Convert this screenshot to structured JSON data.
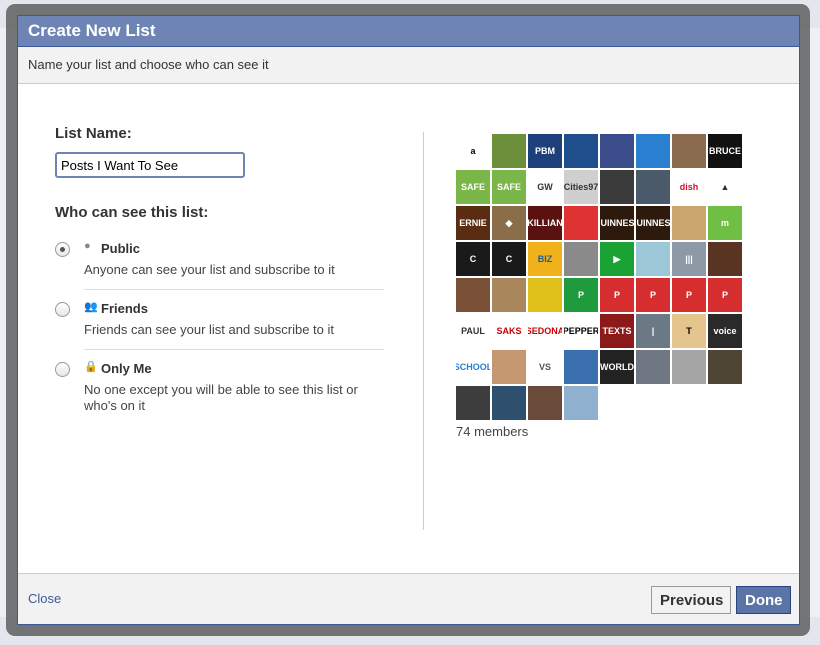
{
  "dialog": {
    "title": "Create New List",
    "subtitle": "Name your list and choose who can see it",
    "list_name_label": "List Name:",
    "list_name_value": "Posts I Want To See",
    "visibility_label": "Who can see this list:",
    "options": [
      {
        "title": "Public",
        "description": "Anyone can see your list and subscribe to it",
        "icon": "globe-icon",
        "checked": true
      },
      {
        "title": "Friends",
        "description": "Friends can see your list and subscribe to it",
        "icon": "friends-icon",
        "checked": false
      },
      {
        "title": "Only Me",
        "description": "No one except you will be able to see this list or who's on it",
        "icon": "lock-icon",
        "checked": false
      }
    ],
    "members_text": "74 members",
    "close_label": "Close",
    "previous_label": "Previous",
    "done_label": "Done"
  },
  "member_tiles": [
    {
      "color": "#ffffff",
      "fg": "#000",
      "text": "a"
    },
    {
      "color": "#6b8f3a",
      "fg": "#fff",
      "text": ""
    },
    {
      "color": "#1d3f7a",
      "fg": "#fff",
      "text": "PBM"
    },
    {
      "color": "#1f4e8c",
      "fg": "#fff",
      "text": ""
    },
    {
      "color": "#3a4d8a",
      "fg": "#fff",
      "text": ""
    },
    {
      "color": "#2a7fd1",
      "fg": "#fff",
      "text": ""
    },
    {
      "color": "#8a6b4d",
      "fg": "#fff",
      "text": ""
    },
    {
      "color": "#111111",
      "fg": "#fff",
      "text": "BRUCE"
    },
    {
      "color": "#7ab648",
      "fg": "#fff",
      "text": "SAFE"
    },
    {
      "color": "#7ab648",
      "fg": "#fff",
      "text": "SAFE"
    },
    {
      "color": "#ffffff",
      "fg": "#333",
      "text": "GW"
    },
    {
      "color": "#cfcfcf",
      "fg": "#333",
      "text": "Cities97"
    },
    {
      "color": "#3b3b3b",
      "fg": "#fff",
      "text": ""
    },
    {
      "color": "#4a5a6a",
      "fg": "#fff",
      "text": ""
    },
    {
      "color": "#ffffff",
      "fg": "#c8102e",
      "text": "dish"
    },
    {
      "color": "#ffffff",
      "fg": "#333",
      "text": "▲"
    },
    {
      "color": "#5a2d12",
      "fg": "#fff",
      "text": "ERNIE"
    },
    {
      "color": "#8b6d4a",
      "fg": "#fff",
      "text": "◆"
    },
    {
      "color": "#5c1111",
      "fg": "#fff",
      "text": "KILLIAN"
    },
    {
      "color": "#d33",
      "fg": "#fff",
      "text": ""
    },
    {
      "color": "#2d1a0c",
      "fg": "#fff",
      "text": "GUINNESS"
    },
    {
      "color": "#2d1a0c",
      "fg": "#fff",
      "text": "GUINNESS"
    },
    {
      "color": "#c9a66b",
      "fg": "#fff",
      "text": ""
    },
    {
      "color": "#6fbf44",
      "fg": "#fff",
      "text": "m"
    },
    {
      "color": "#1a1a1a",
      "fg": "#fff",
      "text": "C"
    },
    {
      "color": "#1a1a1a",
      "fg": "#fff",
      "text": "C"
    },
    {
      "color": "#f0b21b",
      "fg": "#1b5e9c",
      "text": "BIZ"
    },
    {
      "color": "#8a8a8a",
      "fg": "#fff",
      "text": ""
    },
    {
      "color": "#1aa334",
      "fg": "#fff",
      "text": "▶"
    },
    {
      "color": "#9bc7d6",
      "fg": "#fff",
      "text": ""
    },
    {
      "color": "#8d9aa6",
      "fg": "#fff",
      "text": "|||"
    },
    {
      "color": "#5a3422",
      "fg": "#fff",
      "text": ""
    },
    {
      "color": "#7a5036",
      "fg": "#fff",
      "text": ""
    },
    {
      "color": "#a9865c",
      "fg": "#fff",
      "text": ""
    },
    {
      "color": "#e0c11c",
      "fg": "#000",
      "text": ""
    },
    {
      "color": "#1f9a3c",
      "fg": "#fff",
      "text": "P"
    },
    {
      "color": "#d62e2e",
      "fg": "#fff",
      "text": "P"
    },
    {
      "color": "#d62e2e",
      "fg": "#fff",
      "text": "P"
    },
    {
      "color": "#d62e2e",
      "fg": "#fff",
      "text": "P"
    },
    {
      "color": "#d62e2e",
      "fg": "#fff",
      "text": "P"
    },
    {
      "color": "#ffffff",
      "fg": "#333",
      "text": "PAUL"
    },
    {
      "color": "#ffffff",
      "fg": "#c00",
      "text": "SAKS"
    },
    {
      "color": "#ffffff",
      "fg": "#c00",
      "text": "SEDONA"
    },
    {
      "color": "#ffffff",
      "fg": "#000",
      "text": "PEPPER"
    },
    {
      "color": "#8c1a1a",
      "fg": "#fff",
      "text": "TEXTS"
    },
    {
      "color": "#6b7985",
      "fg": "#fff",
      "text": "|"
    },
    {
      "color": "#e6c48d",
      "fg": "#000",
      "text": "T"
    },
    {
      "color": "#2a2a2a",
      "fg": "#fff",
      "text": "voice"
    },
    {
      "color": "#ffffff",
      "fg": "#2a7fd1",
      "text": "SCHOOL"
    },
    {
      "color": "#c69872",
      "fg": "#fff",
      "text": ""
    },
    {
      "color": "#ffffff",
      "fg": "#555",
      "text": "VS"
    },
    {
      "color": "#3a6fb0",
      "fg": "#fff",
      "text": ""
    },
    {
      "color": "#222222",
      "fg": "#fff",
      "text": "WORLD"
    },
    {
      "color": "#6e7782",
      "fg": "#fff",
      "text": ""
    },
    {
      "color": "#a5a5a5",
      "fg": "#fff",
      "text": ""
    },
    {
      "color": "#4f4535",
      "fg": "#fff",
      "text": ""
    },
    {
      "color": "#3d3d3d",
      "fg": "#fff",
      "text": ""
    },
    {
      "color": "#2f4f6f",
      "fg": "#fff",
      "text": ""
    },
    {
      "color": "#6a4a3a",
      "fg": "#fff",
      "text": ""
    },
    {
      "color": "#8fb1cf",
      "fg": "#fff",
      "text": ""
    }
  ]
}
